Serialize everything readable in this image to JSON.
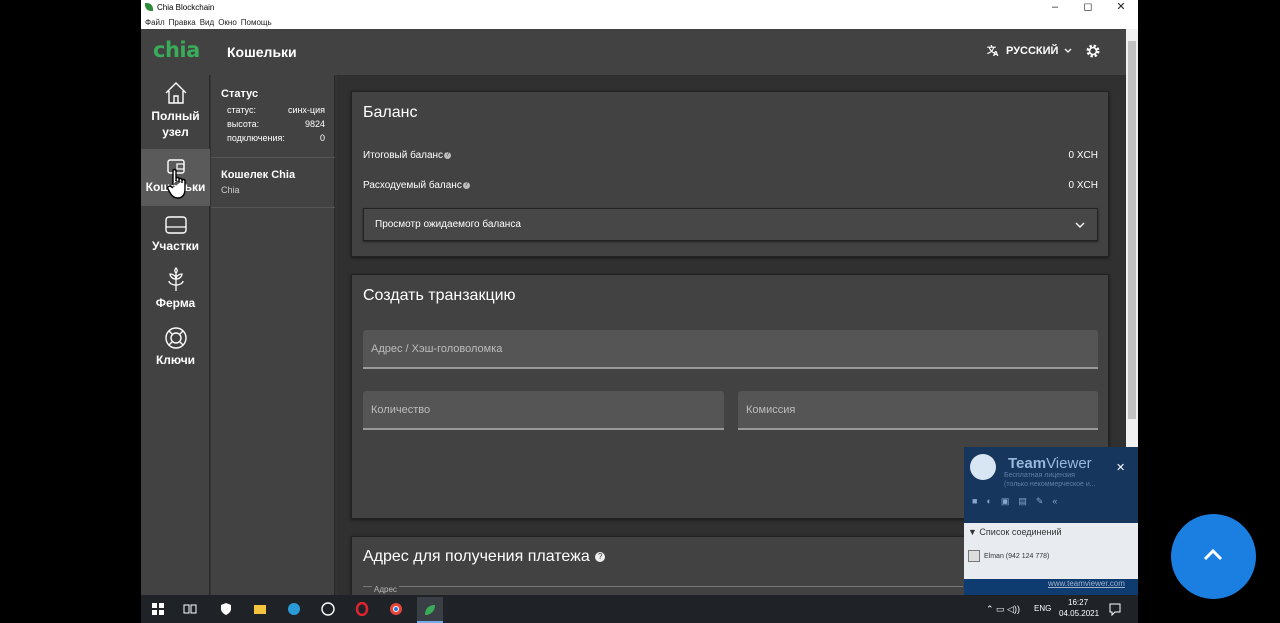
{
  "window": {
    "title": "Chia Blockchain",
    "menu": [
      "Файл",
      "Правка",
      "Вид",
      "Окно",
      "Помощь"
    ],
    "controls": [
      "–",
      "◻",
      "✕"
    ]
  },
  "header": {
    "logo": "chia",
    "title": "Кошельки",
    "language": "РУССКИЙ"
  },
  "nav": {
    "items": [
      {
        "label": "Полный узел",
        "icon": "home-icon"
      },
      {
        "label": "Кошельки",
        "icon": "wallet-icon"
      },
      {
        "label": "Участки",
        "icon": "hdd-icon"
      },
      {
        "label": "Ферма",
        "icon": "sprout-icon"
      },
      {
        "label": "Ключи",
        "icon": "lifebuoy-icon"
      }
    ]
  },
  "status": {
    "heading": "Статус",
    "rows": [
      {
        "k": "статус:",
        "v": "синх-ция"
      },
      {
        "k": "высота:",
        "v": "9824"
      },
      {
        "k": "подключения:",
        "v": "0"
      }
    ]
  },
  "wallet": {
    "name": "Кошелек Chia",
    "type": "Chia"
  },
  "balance": {
    "title": "Баланс",
    "total_label": "Итоговый баланс",
    "total_value": "0 XCH",
    "spendable_label": "Расходуемый баланс",
    "spendable_value": "0 XCH",
    "pending_label": "Просмотр ожидаемого баланса"
  },
  "tx": {
    "title": "Создать транзакцию",
    "address_placeholder": "Адрес / Хэш-головоломка",
    "amount_placeholder": "Количество",
    "fee_placeholder": "Комиссия"
  },
  "receive": {
    "title": "Адрес для получения платежа",
    "address_label": "Адрес"
  },
  "taskbar": {
    "lang": "ENG",
    "time": "16:27",
    "date": "04.05.2021"
  },
  "teamviewer": {
    "name_a": "Team",
    "name_b": "Viewer",
    "license_1": "Бесплатная лицензия",
    "license_2": "(только некоммерческое и...",
    "list_title": "Список соединений",
    "entry": "Elman (942 124 778)",
    "link": "www.teamviewer.com"
  },
  "colors": {
    "accent": "#3aac59",
    "fab": "#1a7fe0"
  }
}
